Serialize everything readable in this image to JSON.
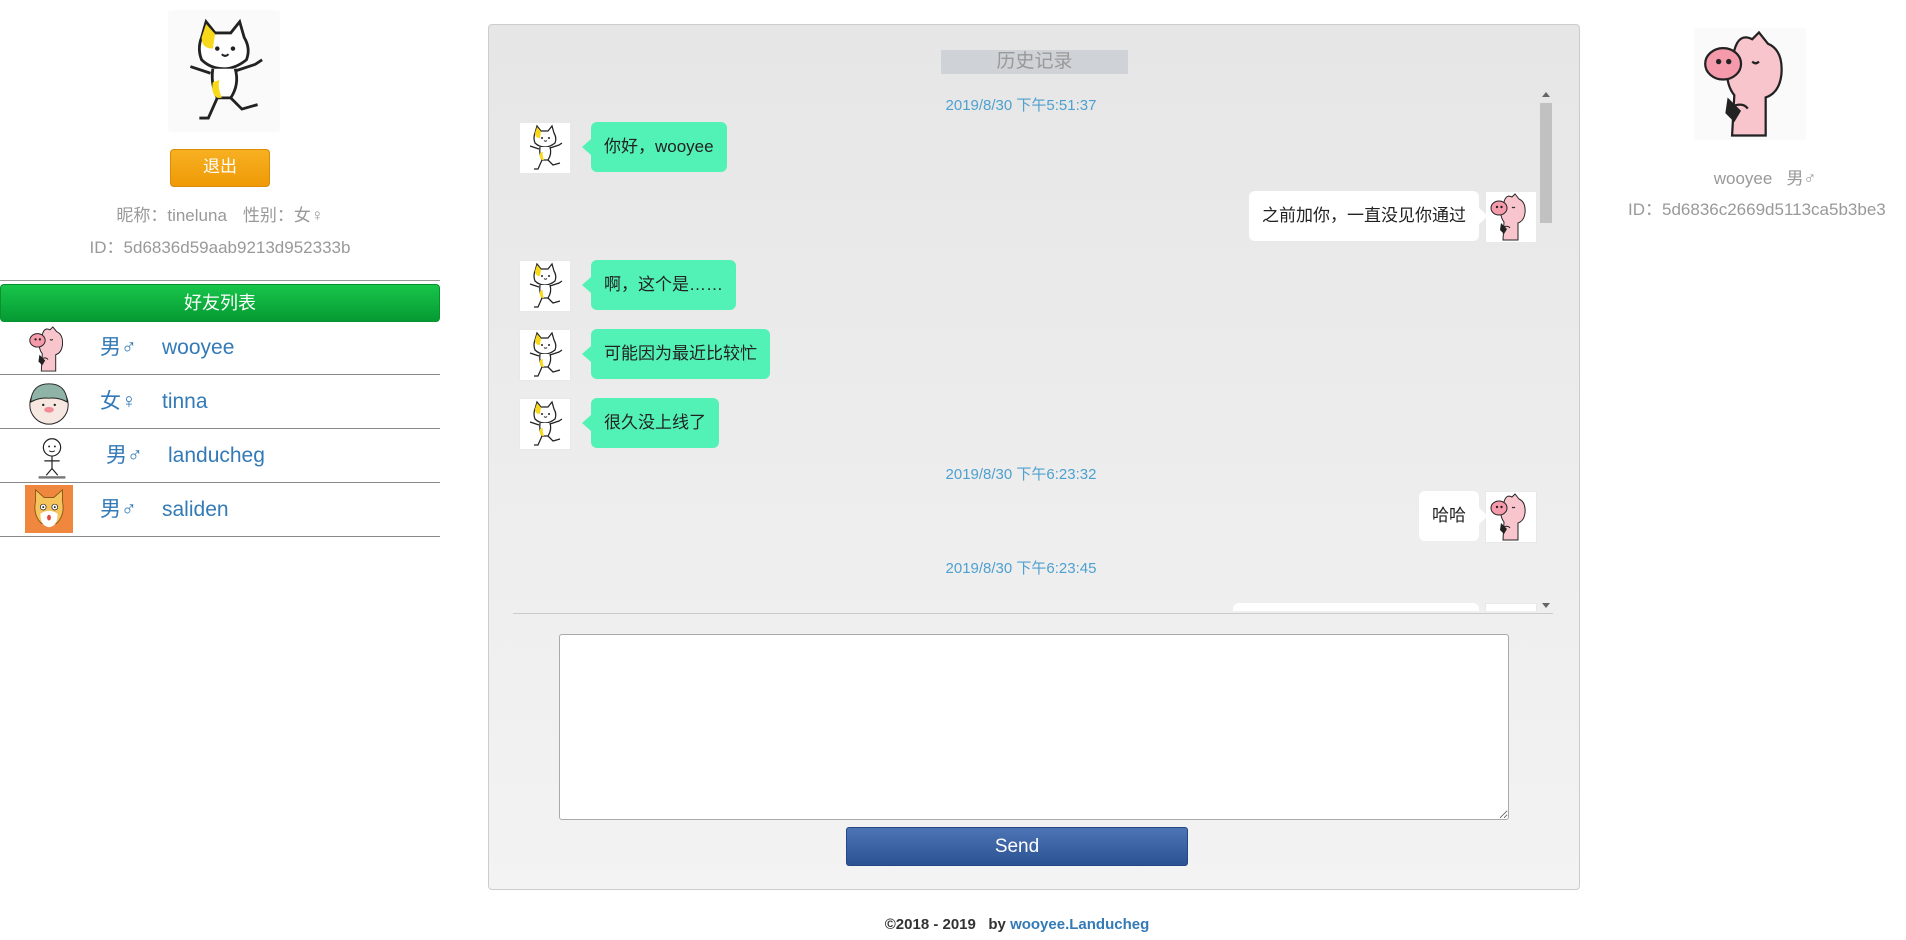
{
  "me": {
    "logout_label": "退出",
    "nickname_label": "昵称：",
    "nickname": "tineluna",
    "gender_label": "性别：",
    "gender": "女♀",
    "id_label": "ID：",
    "id": "5d6836d59aab9213d952333b"
  },
  "friends": {
    "header": "好友列表",
    "items": [
      {
        "gender": "男♂",
        "name": "wooyee"
      },
      {
        "gender": "女♀",
        "name": "tinna"
      },
      {
        "gender": "男♂",
        "name": "landucheg"
      },
      {
        "gender": "男♂",
        "name": "saliden"
      }
    ]
  },
  "chat": {
    "history_label": "历史记录",
    "messages": [
      {
        "type": "timestamp",
        "text": "2019/8/30 下午5:51:37"
      },
      {
        "type": "in",
        "text": "你好，wooyee"
      },
      {
        "type": "out",
        "text": "之前加你，一直没见你通过"
      },
      {
        "type": "in",
        "text": "啊，这个是……"
      },
      {
        "type": "in",
        "text": "可能因为最近比较忙"
      },
      {
        "type": "in",
        "text": "很久没上线了"
      },
      {
        "type": "timestamp",
        "text": "2019/8/30 下午6:23:32"
      },
      {
        "type": "out",
        "text": "哈哈"
      },
      {
        "type": "timestamp",
        "text": "2019/8/30 下午6:23:45"
      }
    ],
    "input_value": "",
    "send_label": "Send"
  },
  "peer": {
    "name": "wooyee",
    "gender": "男♂",
    "id_label": "ID：",
    "id": "5d6836c2669d5113ca5b3be3"
  },
  "footer": {
    "copyright": "©2018 - 2019",
    "by": "by",
    "authors": "wooyee.Landucheg"
  },
  "icons": {
    "my_avatar": "yellow-cat-icon",
    "peer_avatar": "pink-pig-icon"
  }
}
